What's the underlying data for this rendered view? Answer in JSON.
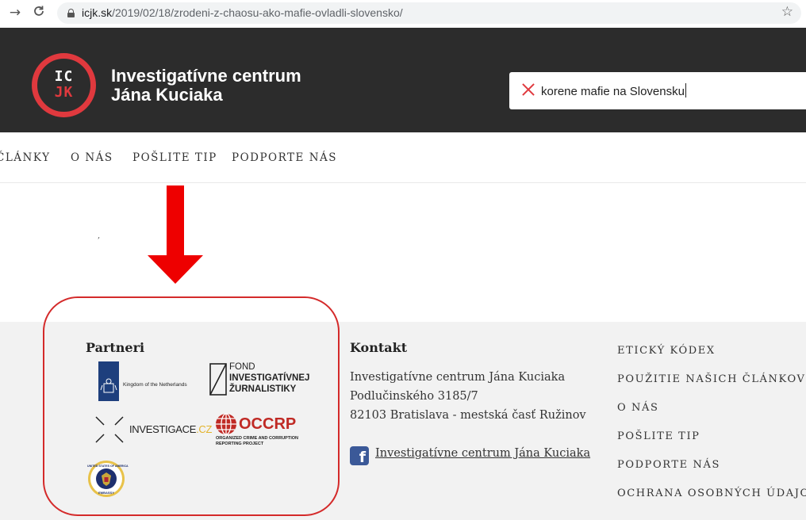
{
  "browser": {
    "url_domain": "icjk.sk",
    "url_path": "/2019/02/18/zrodeni-z-chaosu-ako-mafie-ovladli-slovensko/",
    "back_icon": "→",
    "reload_icon": "C",
    "star_icon": "☆"
  },
  "header": {
    "logo_top": "IC",
    "logo_bottom": "JK",
    "title_line1": "Investigatívne centrum",
    "title_line2": "Jána Kuciaka",
    "search_value": "korene mafie na Slovensku"
  },
  "nav": {
    "items": [
      "ČLÁNKY",
      "O NÁS",
      "POŠLITE TIP",
      "PODPORTE NÁS"
    ]
  },
  "stray": ",",
  "footer": {
    "partners_heading": "Partneri",
    "partners": {
      "netherlands": "Kingdom of the Netherlands",
      "fond_line1": "FOND",
      "fond_line2": "INVESTIGATÍVNEJ",
      "fond_line3": "ŽURNALISTIKY",
      "investigace": "INVESTIGACE",
      "investigace_suffix": ".CZ",
      "occrp": "OCCRP",
      "occrp_sub1": "ORGANIZED CRIME AND CORRUPTION",
      "occrp_sub2": "REPORTING PROJECT",
      "embassy_top": "UNITED STATES OF AMERICA",
      "embassy_bottom": "EMBASSY"
    },
    "contact_heading": "Kontakt",
    "contact_lines": [
      "Investigatívne centrum Jána Kuciaka",
      "Podlučinského 3185/7",
      "82103 Bratislava - mestská časť Ružinov"
    ],
    "facebook_icon": "f",
    "facebook_link": "Investigatívne centrum Jána Kuciaka",
    "links": [
      "ETICKÝ KÓDEX",
      "POUŽITIE NAŠICH ČLÁNKOV",
      "O NÁS",
      "POŠLITE TIP",
      "PODPORTE NÁS",
      "OCHRANA OSOBNÝCH ÚDAJOV"
    ]
  },
  "colors": {
    "header_bg": "#2c2c2c",
    "brand_red": "#e0393e",
    "annotation_red": "#d42a2a",
    "footer_bg": "#f2f2f2"
  }
}
